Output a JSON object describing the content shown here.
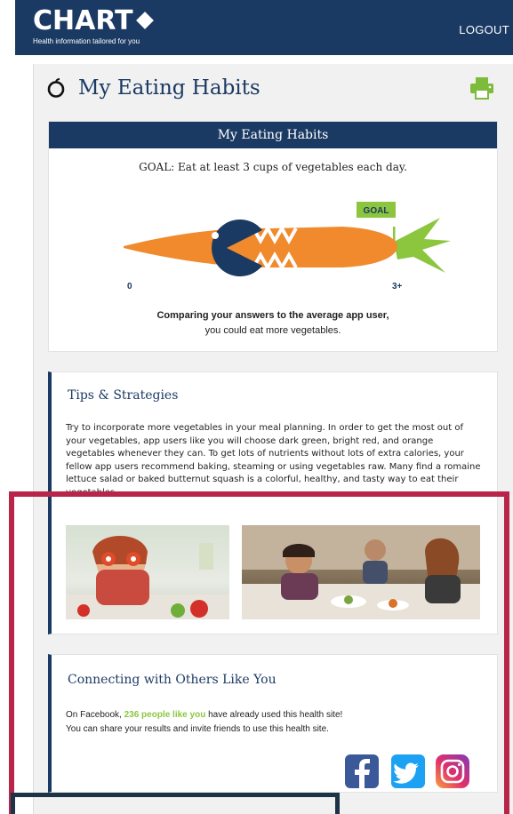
{
  "header": {
    "logo_text": "CHART",
    "logo_tagline": "Health information tailored for you",
    "logout_label": "LOGOUT"
  },
  "page": {
    "title": "My Eating Habits",
    "title_icon": "apple-icon",
    "print_icon": "print-icon"
  },
  "habits_card": {
    "heading": "My Eating Habits",
    "goal_text": "GOAL: Eat at least 3 cups of vegetables each day.",
    "goal_flag_label": "GOAL",
    "scale_min": "0",
    "scale_max": "3+",
    "progress_fraction": 0.3,
    "compare_bold": "Comparing your answers to the average app user,",
    "compare_rest": "you could eat more vegetables."
  },
  "tips": {
    "title": "Tips & Strategies",
    "body": "Try to incorporate more vegetables in your meal planning. In order to get the most out of your vegetables, app users like you will choose dark green, bright red, and orange vegetables whenever they can. To get lots of nutrients without lots of extra calories, your fellow app users recommend baking, steaming or using vegetables raw. Many find a romaine lettuce salad or baked butternut squash is a colorful, healthy, and tasty way to eat their vegetables."
  },
  "connect": {
    "title": "Connecting with Others Like You",
    "line1_prefix": "On Facebook, ",
    "line1_highlight": "236 people like you",
    "line1_suffix": " have already used this health site!",
    "line2": "You can share your results and invite friends to use this health site."
  },
  "colors": {
    "brand_navy": "#1b3a63",
    "carrot_orange": "#f08a2c",
    "goal_green": "#8cc63f",
    "highlight_red": "#b8244a",
    "facebook_blue": "#3b5998",
    "twitter_blue": "#1da1f2"
  }
}
